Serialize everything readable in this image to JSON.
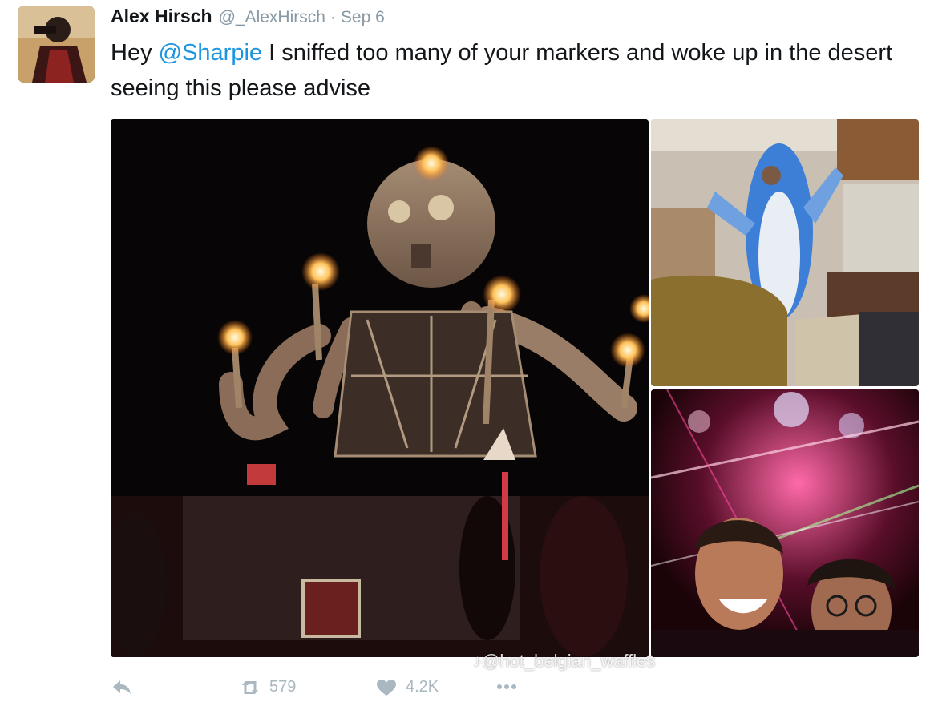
{
  "tweet": {
    "author_name": "Alex Hirsch",
    "author_handle": "@_AlexHirsch",
    "separator": "·",
    "date": "Sep 6",
    "text_before_mention": "Hey ",
    "mention": "@Sharpie",
    "text_after_mention": " I sniffed too many of your markers and woke up in the desert seeing this please advise"
  },
  "overlay": {
    "watermark": "@hot_belgian_waffles"
  },
  "actions": {
    "retweet_count": "579",
    "like_count": "4.2K"
  },
  "icons": {
    "reply": "reply-icon",
    "retweet": "retweet-icon",
    "like": "heart-icon",
    "more": "more-icon"
  },
  "colors": {
    "mention": "#1b95e0",
    "meta": "#8899a6",
    "action": "#aab8c2"
  }
}
